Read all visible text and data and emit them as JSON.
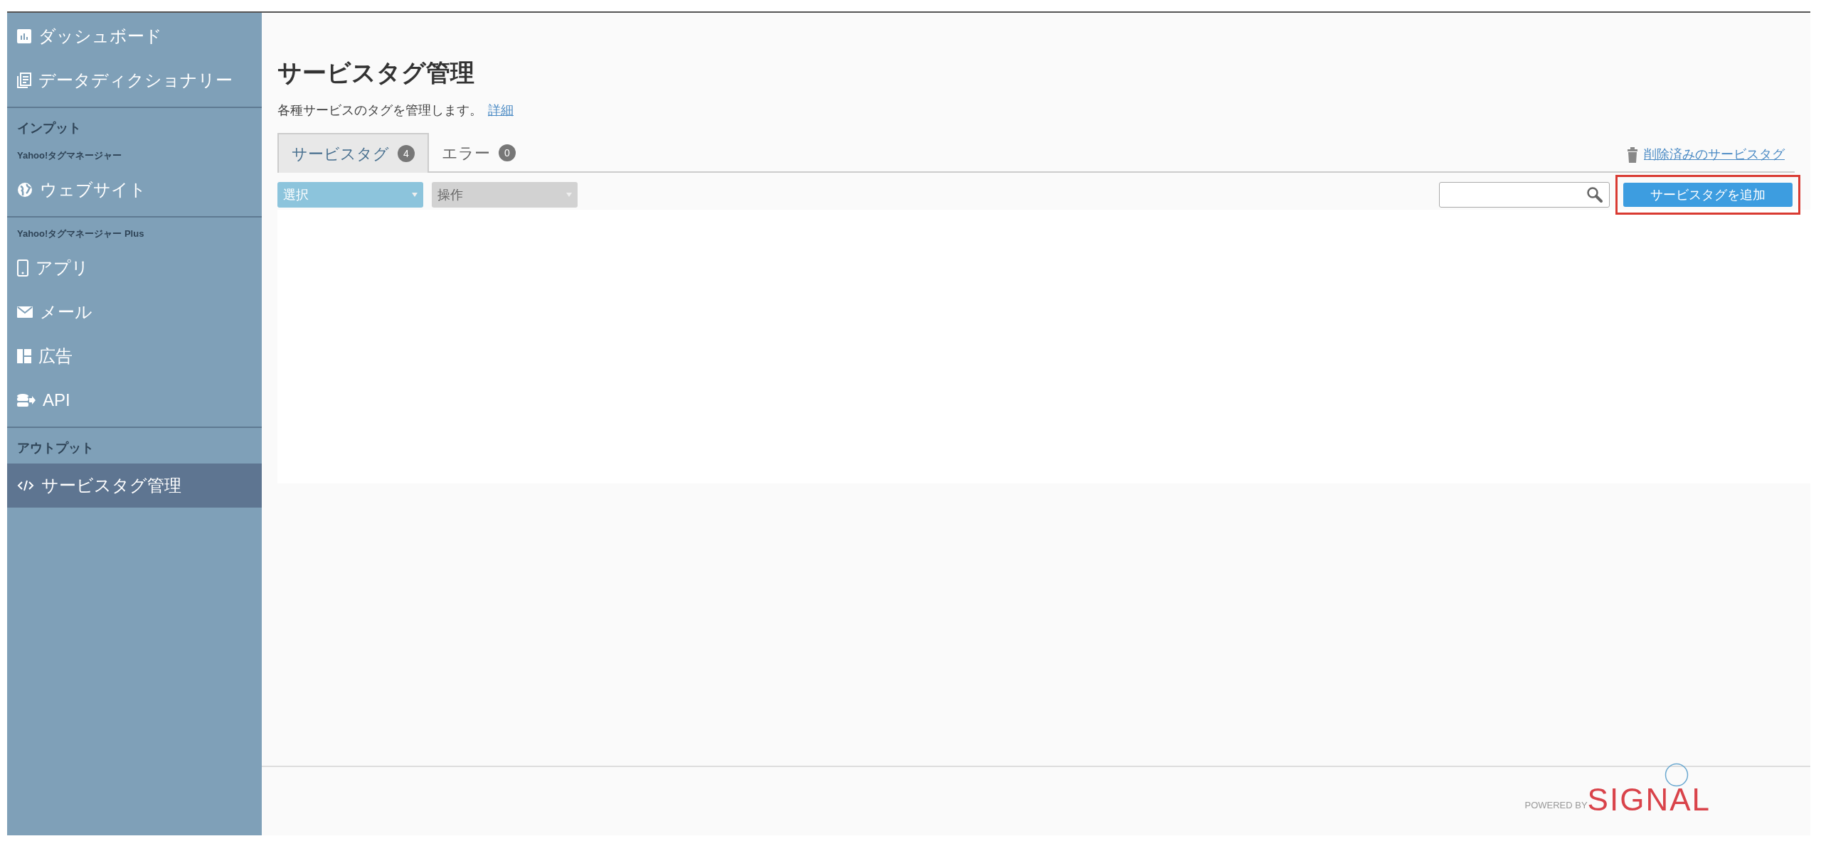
{
  "sidebar": {
    "items": [
      {
        "kind": "link",
        "label": "ダッシュボード",
        "selected": false
      },
      {
        "kind": "link",
        "label": "データディクショナリー",
        "selected": false
      },
      {
        "kind": "divider"
      },
      {
        "kind": "section",
        "label": "インプット"
      },
      {
        "kind": "subsection",
        "label": "Yahoo!タグマネージャー"
      },
      {
        "kind": "link",
        "label": "ウェブサイト",
        "selected": false
      },
      {
        "kind": "divider"
      },
      {
        "kind": "subsection",
        "label": "Yahoo!タグマネージャー Plus"
      },
      {
        "kind": "link",
        "label": "アプリ",
        "selected": false
      },
      {
        "kind": "link",
        "label": "メール",
        "selected": false
      },
      {
        "kind": "link",
        "label": "広告",
        "selected": false
      },
      {
        "kind": "link",
        "label": "API",
        "selected": false
      },
      {
        "kind": "divider"
      },
      {
        "kind": "section",
        "label": "アウトプット"
      },
      {
        "kind": "link",
        "label": "サービスタグ管理",
        "selected": true
      }
    ]
  },
  "page": {
    "title": "サービスタグ管理",
    "description": "各種サービスのタグを管理します。",
    "detail_link": "詳細"
  },
  "tabs": [
    {
      "label": "サービスタグ",
      "count": "4",
      "selected": true
    },
    {
      "label": "エラー",
      "count": "0",
      "selected": false
    }
  ],
  "deleted_link": "削除済みのサービスタグ",
  "dropdowns": [
    {
      "label": "選択",
      "disabled": false
    },
    {
      "label": "操作",
      "disabled": true
    }
  ],
  "add_button": {
    "label": "サービスタグを追加",
    "highlighted": true
  },
  "footer": {
    "powered_by": "POWERED BY",
    "brand": "SIGNAL"
  }
}
